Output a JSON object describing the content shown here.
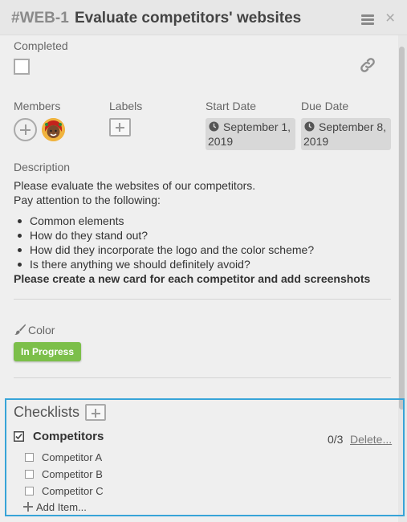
{
  "header": {
    "card_id": "#WEB-1",
    "title": "Evaluate competitors' websites",
    "menu_icon": "hamburger-menu-icon",
    "close_icon": "close-icon",
    "close_glyph": "×"
  },
  "completed": {
    "label": "Completed",
    "checked": false
  },
  "link_icon": "link-icon",
  "members": {
    "label": "Members",
    "add_icon": "add-member-icon",
    "avatar_icon": "user-avatar"
  },
  "labels": {
    "label": "Labels",
    "add_icon": "add-label-icon"
  },
  "start_date": {
    "label": "Start Date",
    "line1": "September 1,",
    "line2": "2019",
    "icon": "clock-icon"
  },
  "due_date": {
    "label": "Due Date",
    "line1": "September 8,",
    "line2": "2019",
    "icon": "clock-icon"
  },
  "description": {
    "label": "Description",
    "line1": "Please evaluate the websites of our competitors.",
    "line2": "Pay attention to the following:",
    "bullets": [
      "Common elements",
      "How do they stand out?",
      "How did they incorporate the logo and the color scheme?",
      "Is there anything we should definitely avoid?"
    ],
    "bold_line": "Please create a new card for each competitor and add screenshots"
  },
  "color": {
    "label": "Color",
    "icon": "paintbrush-icon",
    "badge": "In Progress",
    "badge_color": "#7cbf4a"
  },
  "checklists": {
    "title": "Checklists",
    "add_icon": "add-checklist-icon",
    "accent_color": "#37a4d8",
    "list": {
      "name": "Competitors",
      "count": "0/3",
      "delete_label": "Delete...",
      "items": [
        {
          "label": "Competitor A",
          "checked": false
        },
        {
          "label": "Competitor B",
          "checked": false
        },
        {
          "label": "Competitor C",
          "checked": false
        }
      ],
      "add_item_label": "Add Item..."
    }
  }
}
